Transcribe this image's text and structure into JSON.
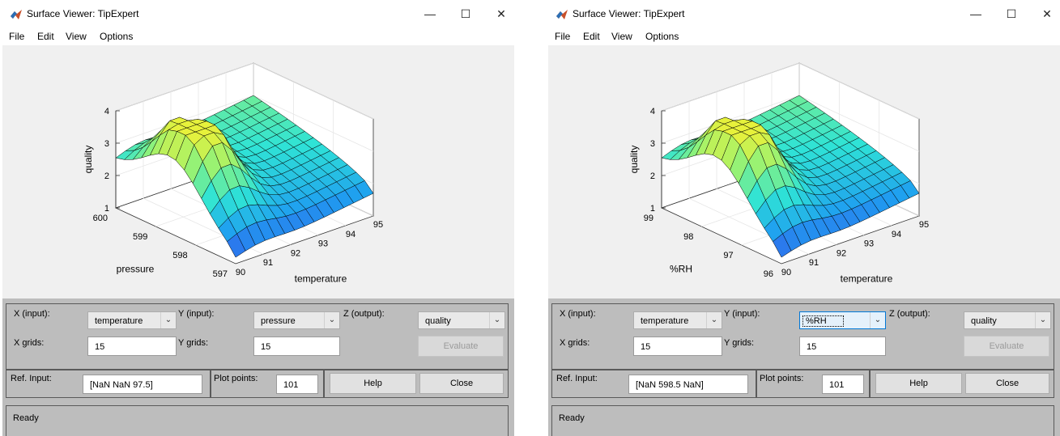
{
  "windows": [
    {
      "id": "w0",
      "title": "Surface Viewer: TipExpert",
      "window_controls": {
        "minimize": "—",
        "maximize": "☐",
        "close": "✕"
      },
      "menu": [
        "File",
        "Edit",
        "View",
        "Options"
      ],
      "plot": {
        "zlabel": "quality",
        "z_ticks": [
          "1",
          "2",
          "3",
          "4"
        ],
        "x_axis_label": "temperature",
        "x_ticks": [
          "90",
          "91",
          "92",
          "93",
          "94",
          "95"
        ],
        "y_axis_label": "pressure",
        "y_ticks": [
          "597",
          "598",
          "599",
          "600"
        ]
      },
      "controls": {
        "x_input_label": "X (input):",
        "x_input_value": "temperature",
        "y_input_label": "Y (input):",
        "y_input_value": "pressure",
        "z_output_label": "Z (output):",
        "z_output_value": "quality",
        "x_grids_label": "X grids:",
        "x_grids_value": "15",
        "y_grids_label": "Y grids:",
        "y_grids_value": "15",
        "evaluate_label": "Evaluate",
        "ref_input_label": "Ref. Input:",
        "ref_input_value": "[NaN NaN 97.5]",
        "plot_points_label": "Plot points:",
        "plot_points_value": "101",
        "help_label": "Help",
        "close_label": "Close",
        "status": "Ready"
      }
    },
    {
      "id": "w1",
      "title": "Surface Viewer: TipExpert",
      "window_controls": {
        "minimize": "—",
        "maximize": "☐",
        "close": "✕"
      },
      "menu": [
        "File",
        "Edit",
        "View",
        "Options"
      ],
      "plot": {
        "zlabel": "quality",
        "z_ticks": [
          "1",
          "2",
          "3",
          "4"
        ],
        "x_axis_label": "temperature",
        "x_ticks": [
          "90",
          "91",
          "92",
          "93",
          "94",
          "95"
        ],
        "y_axis_label": "%RH",
        "y_ticks": [
          "96",
          "97",
          "98",
          "99"
        ]
      },
      "controls": {
        "x_input_label": "X (input):",
        "x_input_value": "temperature",
        "y_input_label": "Y (input):",
        "y_input_value": "%RH",
        "z_output_label": "Z (output):",
        "z_output_value": "quality",
        "x_grids_label": "X grids:",
        "x_grids_value": "15",
        "y_grids_label": "Y grids:",
        "y_grids_value": "15",
        "evaluate_label": "Evaluate",
        "ref_input_label": "Ref. Input:",
        "ref_input_value": "[NaN 598.5 NaN]",
        "plot_points_label": "Plot points:",
        "plot_points_value": "101",
        "help_label": "Help",
        "close_label": "Close",
        "status": "Ready"
      }
    }
  ],
  "colormap": [
    "#3b47e8",
    "#1f9ff0",
    "#2fe3d6",
    "#8cf27c",
    "#e7f13b"
  ]
}
